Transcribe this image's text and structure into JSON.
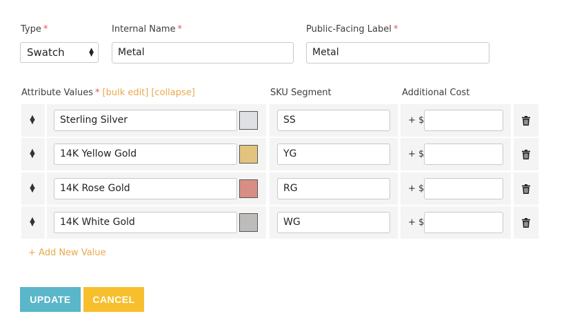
{
  "form": {
    "type": {
      "label": "Type",
      "required_mark": "*",
      "value": "Swatch"
    },
    "internal_name": {
      "label": "Internal Name",
      "required_mark": "*",
      "value": "Metal"
    },
    "public_label": {
      "label": "Public-Facing Label",
      "required_mark": "*",
      "value": "Metal"
    }
  },
  "attributes": {
    "header": {
      "values_label": "Attribute Values",
      "required_mark": "*",
      "bulk_edit": "[bulk edit]",
      "collapse": "[collapse]",
      "sku_label": "SKU Segment",
      "cost_label": "Additional Cost"
    },
    "rows": [
      {
        "name": "Sterling Silver",
        "swatch_color": "#dfe0e3",
        "sku": "SS",
        "cost_prefix": "+ $",
        "cost": ""
      },
      {
        "name": "14K Yellow Gold",
        "swatch_color": "#e2c47f",
        "sku": "YG",
        "cost_prefix": "+ $",
        "cost": ""
      },
      {
        "name": "14K Rose Gold",
        "swatch_color": "#d98e84",
        "sku": "RG",
        "cost_prefix": "+ $",
        "cost": ""
      },
      {
        "name": "14K White Gold",
        "swatch_color": "#bdbcba",
        "sku": "WG",
        "cost_prefix": "+ $",
        "cost": ""
      }
    ],
    "add_new": "+ Add New Value"
  },
  "actions": {
    "update_label": "UPDATE",
    "cancel_label": "CANCEL",
    "update_color": "#5ab6c9",
    "cancel_color": "#f7bf2d"
  },
  "colors": {
    "accent": "#e8a94a",
    "required": "#d9534f"
  }
}
